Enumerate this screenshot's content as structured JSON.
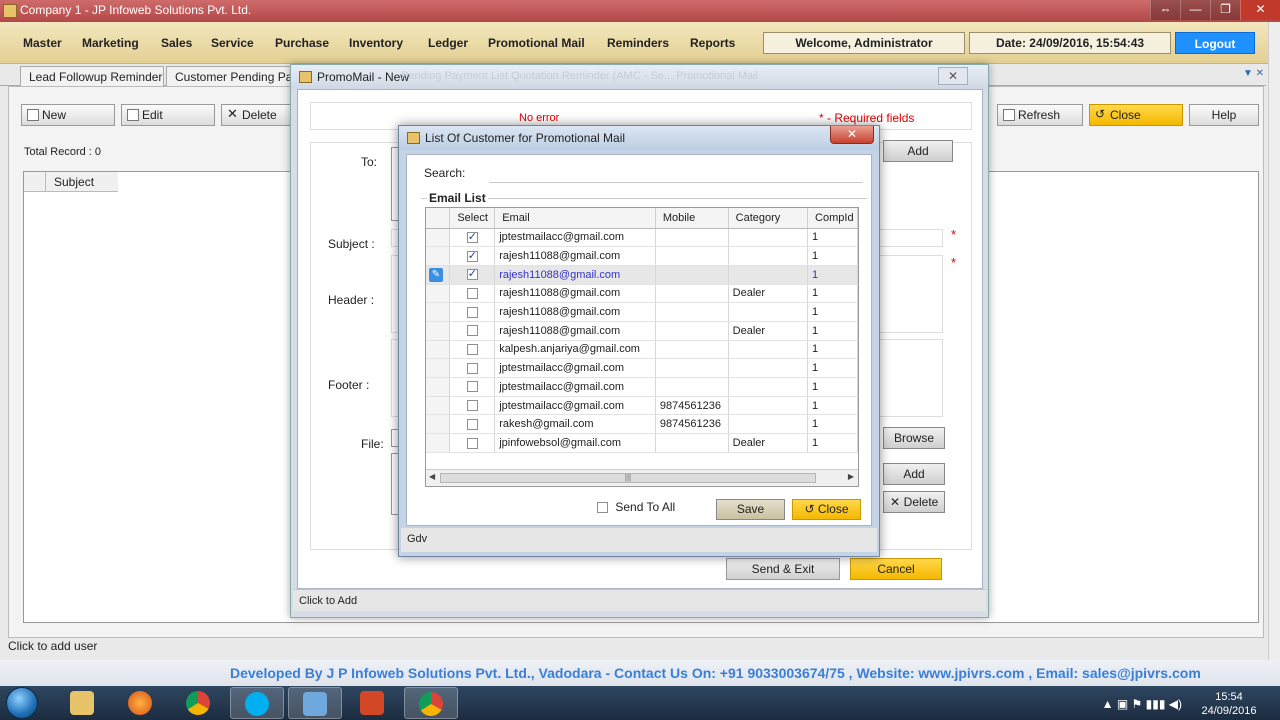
{
  "app": {
    "title": "Company 1 - JP Infoweb Solutions Pvt. Ltd.",
    "win_buttons": [
      "⇔",
      "—",
      "❐",
      "✕"
    ]
  },
  "menu": {
    "items": [
      "Master",
      "Marketing",
      "Sales",
      "Service",
      "Purchase",
      "Inventory",
      "Ledger",
      "Promotional Mail",
      "Reminders",
      "Reports"
    ],
    "welcome": "Welcome, Administrator",
    "date": "Date: 24/09/2016, 15:54:43",
    "logout": "Logout"
  },
  "tabs": [
    "Lead Followup Reminder",
    "Customer Pending Pay"
  ],
  "tabs_faded": [
    "Pending Payment List",
    "Quotation Reminder (AMC - Se...",
    "Promotional Mail"
  ],
  "toolbar": {
    "new": "New",
    "edit": "Edit",
    "delete": "Delete",
    "refresh": "Refresh",
    "close": "Close",
    "help": "Help"
  },
  "main": {
    "total_record": "Total Record : 0",
    "subject_col": "Subject",
    "status": "Click to add user"
  },
  "footer_banner": "Developed By J P Infoweb Solutions Pvt. Ltd., Vadodara - Contact Us On: +91 9033003674/75 , Website: www.jpivrs.com , Email: sales@jpivrs.com",
  "promo": {
    "title": "PromoMail - New",
    "ghost_tabs": "Pending Payment List     Quotation Reminder (AMC - Se...     Promotional Mail",
    "no_error": "No error",
    "required": "* - Required fields",
    "labels": {
      "to": "To:",
      "subject": "Subject :",
      "header": "Header :",
      "footer": "Footer :",
      "file": "File:"
    },
    "add": "Add",
    "browse": "Browse",
    "add2": "Add",
    "delete": "Delete",
    "send_exit": "Send & Exit",
    "cancel": "Cancel",
    "status": "Click to Add"
  },
  "dialog": {
    "title": "List Of Customer for Promotional Mail",
    "search_label": "Search:",
    "search_value": "",
    "group_title": "Email List",
    "columns": [
      "Select",
      "Email",
      "Mobile",
      "Category",
      "CompId"
    ],
    "rows": [
      {
        "checked": true,
        "email": "jptestmailacc@gmail.com",
        "mobile": "",
        "category": "",
        "compid": "1"
      },
      {
        "checked": true,
        "email": "rajesh11088@gmail.com",
        "mobile": "",
        "category": "",
        "compid": "1"
      },
      {
        "checked": true,
        "email": "rajesh11088@gmail.com",
        "mobile": "",
        "category": "",
        "compid": "1"
      },
      {
        "checked": false,
        "email": "rajesh11088@gmail.com",
        "mobile": "",
        "category": "Dealer",
        "compid": "1"
      },
      {
        "checked": false,
        "email": "rajesh11088@gmail.com",
        "mobile": "",
        "category": "",
        "compid": "1"
      },
      {
        "checked": false,
        "email": "rajesh11088@gmail.com",
        "mobile": "",
        "category": "Dealer",
        "compid": "1"
      },
      {
        "checked": false,
        "email": "kalpesh.anjariya@gmail.com",
        "mobile": "",
        "category": "",
        "compid": "1"
      },
      {
        "checked": false,
        "email": "jptestmailacc@gmail.com",
        "mobile": "",
        "category": "",
        "compid": "1"
      },
      {
        "checked": false,
        "email": "jptestmailacc@gmail.com",
        "mobile": "",
        "category": "",
        "compid": "1"
      },
      {
        "checked": false,
        "email": "jptestmailacc@gmail.com",
        "mobile": "9874561236",
        "category": "",
        "compid": "1"
      },
      {
        "checked": false,
        "email": "rakesh@gmail.com",
        "mobile": "9874561236",
        "category": "",
        "compid": "1"
      },
      {
        "checked": false,
        "email": "jpinfowebsol@gmail.com",
        "mobile": "",
        "category": "Dealer",
        "compid": "1"
      }
    ],
    "selected_row": 2,
    "send_to_all": "Send To All",
    "save": "Save",
    "close": "Close",
    "status": "Gdv"
  },
  "taskbar": {
    "time": "15:54",
    "date": "24/09/2016"
  }
}
